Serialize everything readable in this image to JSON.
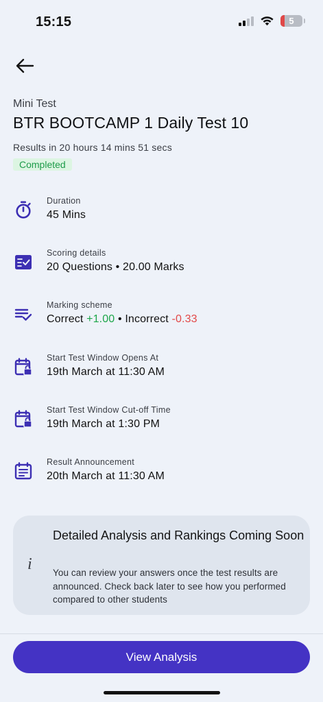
{
  "status_bar": {
    "time": "15:15",
    "battery_level": "5",
    "icons": [
      "signal-icon",
      "wifi-icon",
      "battery-icon"
    ]
  },
  "header": {
    "back_icon": "arrow-left-icon"
  },
  "test": {
    "type": "Mini Test",
    "title": "BTR BOOTCAMP 1 Daily Test 10",
    "results_eta": "Results in 20 hours 14 mins 51 secs",
    "status": "Completed"
  },
  "details": {
    "duration": {
      "label": "Duration",
      "value": "45 Mins",
      "icon": "stopwatch-icon"
    },
    "scoring": {
      "label": "Scoring details",
      "value": "20 Questions • 20.00 Marks",
      "icon": "checklist-icon"
    },
    "marking": {
      "label": "Marking scheme",
      "correct_label": "Correct",
      "correct_value": "+1.00",
      "separator": " • ",
      "incorrect_label": "Incorrect",
      "incorrect_value": "-0.33",
      "icon": "list-check-icon"
    },
    "window_opens": {
      "label": "Start Test Window Opens At",
      "value": "19th March at 11:30 AM",
      "icon": "calendar-lock-icon"
    },
    "window_cutoff": {
      "label": "Start Test Window Cut-off Time",
      "value": "19th March at 1:30 PM",
      "icon": "calendar-lock-icon"
    },
    "result_announcement": {
      "label": "Result Announcement",
      "value": "20th March at 11:30 AM",
      "icon": "calendar-note-icon"
    }
  },
  "info_card": {
    "icon": "info-icon",
    "icon_glyph": "i",
    "title": "Detailed Analysis and Rankings Coming Soon",
    "body": "You can review your answers once the test results are announced. Check back later to see how you performed compared to other students"
  },
  "actions": {
    "view_analysis_label": "View Analysis"
  },
  "colors": {
    "accent": "#4433c4",
    "icon": "#3c2fb3",
    "success": "#1da64a",
    "danger": "#e24848",
    "badge_bg": "#dcf5e2"
  }
}
